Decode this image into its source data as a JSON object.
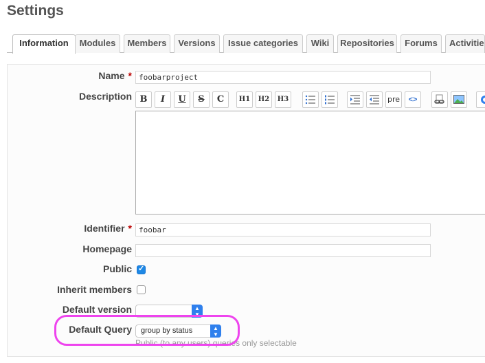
{
  "page": {
    "title": "Settings"
  },
  "tabs": [
    {
      "label": "Information",
      "selected": true
    },
    {
      "label": "Modules"
    },
    {
      "label": "Members"
    },
    {
      "label": "Versions"
    },
    {
      "label": "Issue categories"
    },
    {
      "label": "Wiki"
    },
    {
      "label": "Repositories"
    },
    {
      "label": "Forums"
    },
    {
      "label": "Activities"
    }
  ],
  "form": {
    "name": {
      "label": "Name",
      "required_mark": "*",
      "value": "foobarproject"
    },
    "description": {
      "label": "Description",
      "value": ""
    },
    "toolbar": {
      "bold": "B",
      "italic": "I",
      "underline": "U",
      "strike": "S",
      "code": "C",
      "h1": "H1",
      "h2": "H2",
      "h3": "H3",
      "pre": "pre",
      "code_block": "<>"
    },
    "identifier": {
      "label": "Identifier",
      "required_mark": "*",
      "value": "foobar"
    },
    "homepage": {
      "label": "Homepage",
      "value": ""
    },
    "public": {
      "label": "Public",
      "checked": true
    },
    "inherit_members": {
      "label": "Inherit members",
      "checked": false
    },
    "default_version": {
      "label": "Default version",
      "value": ""
    },
    "default_query": {
      "label": "Default Query",
      "value": "group by status",
      "hint": "Public (to any users) queries only selectable"
    }
  },
  "colors": {
    "highlight": "#ee44ee",
    "accent": "#2f80ed",
    "required": "#bb0000"
  }
}
